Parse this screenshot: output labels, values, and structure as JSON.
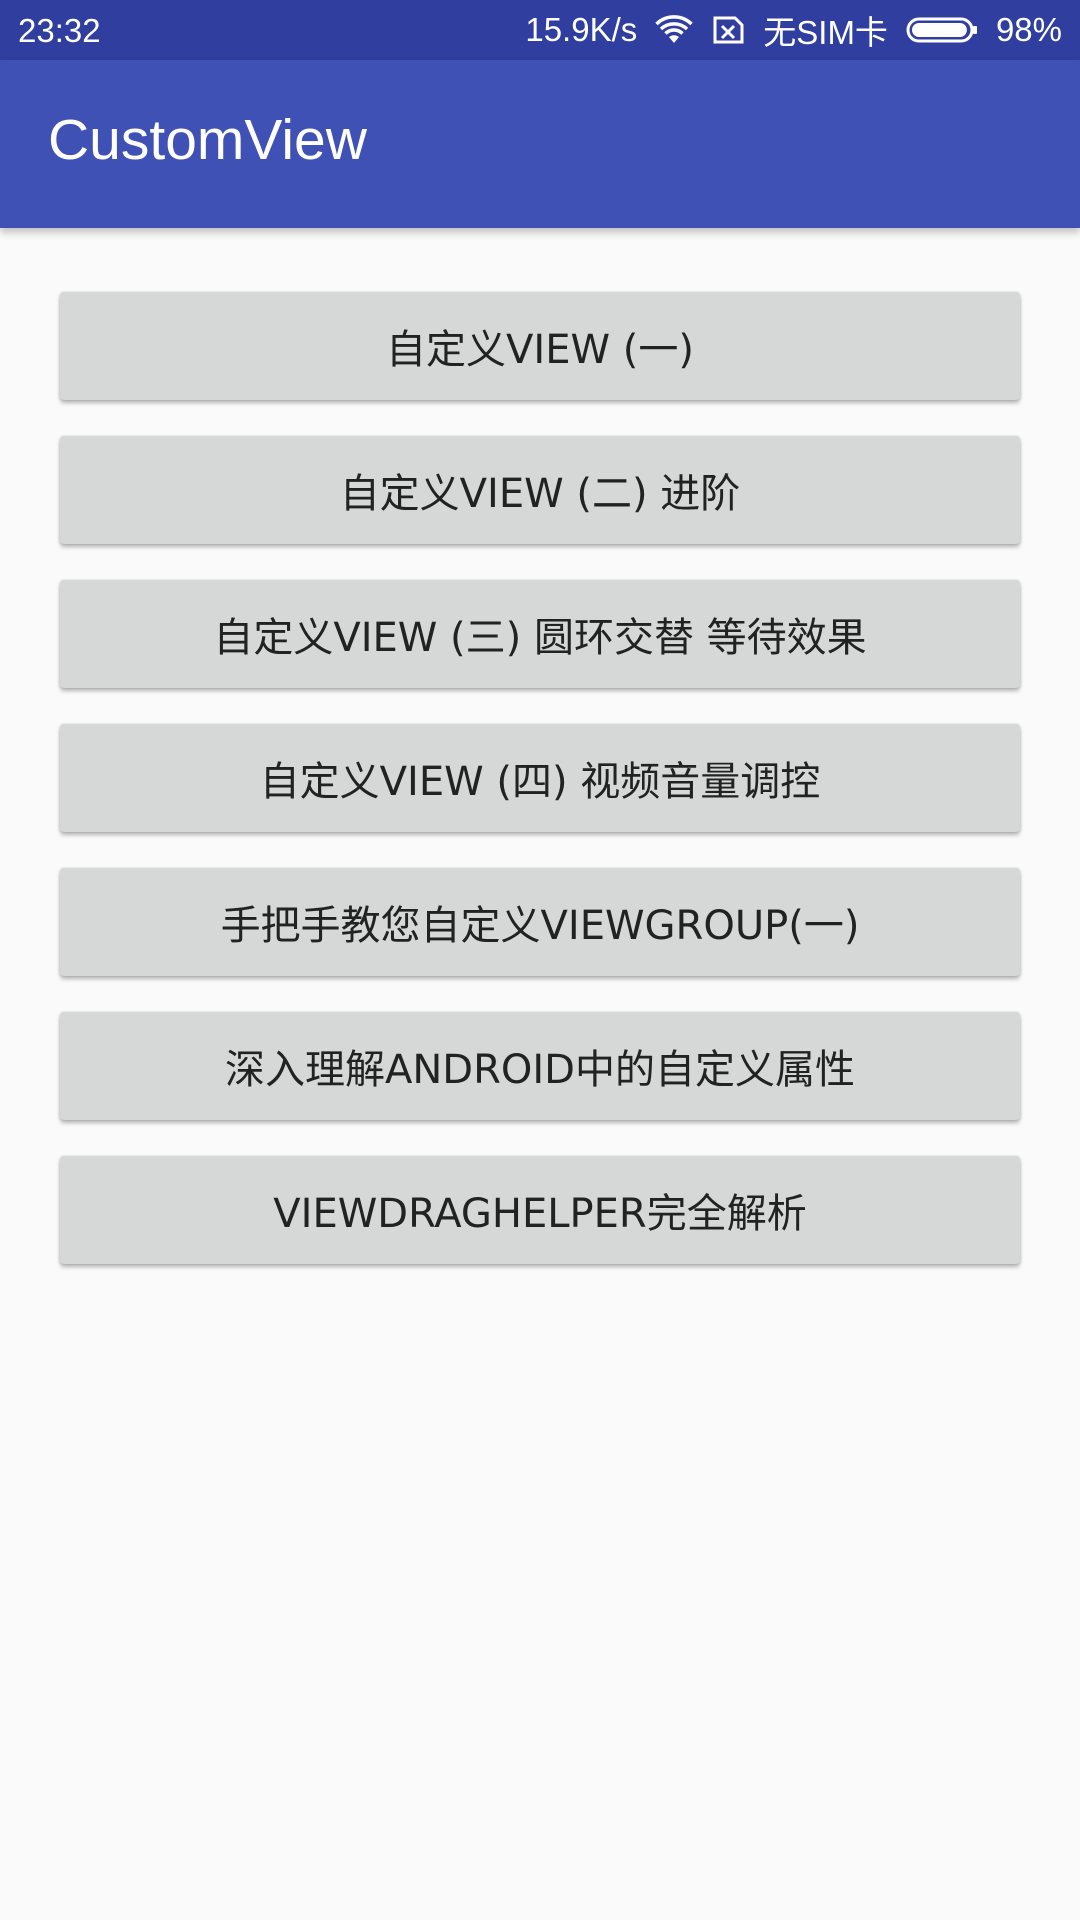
{
  "status_bar": {
    "time": "23:32",
    "network_speed": "15.9K/s",
    "wifi_icon": "wifi-icon",
    "sim_icon": "no-sim-icon",
    "sim_text": "无SIM卡",
    "battery_icon": "battery-icon",
    "battery_level": 0.98,
    "battery_text": "98%"
  },
  "app_bar": {
    "title": "CustomView"
  },
  "buttons": [
    {
      "label": "自定义VIEW (一)"
    },
    {
      "label": "自定义VIEW (二) 进阶"
    },
    {
      "label": "自定义VIEW (三) 圆环交替 等待效果"
    },
    {
      "label": "自定义VIEW (四) 视频音量调控"
    },
    {
      "label": "手把手教您自定义VIEWGROUP(一)"
    },
    {
      "label": "深入理解ANDROID中的自定义属性"
    },
    {
      "label": "VIEWDRAGHELPER完全解析"
    }
  ],
  "colors": {
    "status_bar": "#303f9f",
    "app_bar": "#3f51b5",
    "background": "#fafafa",
    "button": "#d6d7d7",
    "button_text": "#222222"
  }
}
